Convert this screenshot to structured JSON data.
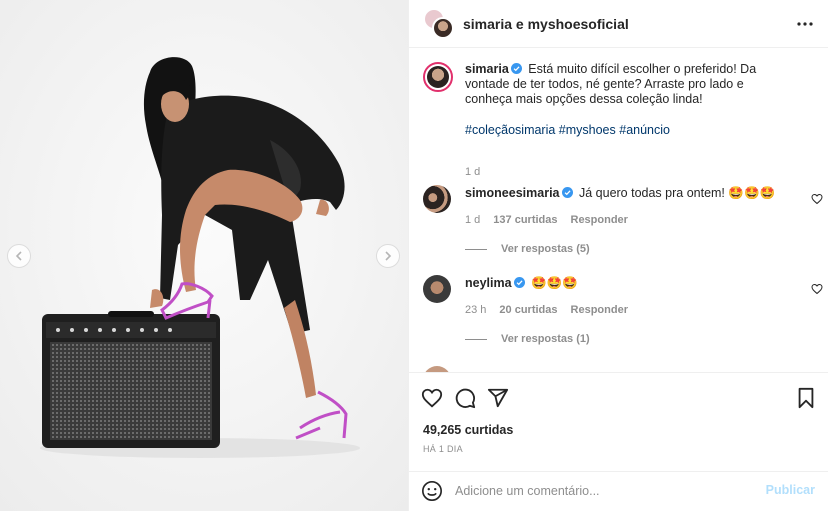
{
  "header": {
    "title": "simaria e myshoesoficial",
    "more_icon": "more-horizontal-icon"
  },
  "caption": {
    "username": "simaria",
    "text": "Está muito difícil escolher o preferido! Da vontade de ter todos, né gente? Arraste pro lado e conheça mais opções dessa coleção linda!",
    "hashtags": "#coleçãosimaria #myshoes #anúncio",
    "time": "1 d"
  },
  "comments": [
    {
      "username": "simoneesimaria",
      "text": "Já quero todas pra ontem! 🤩🤩🤩",
      "time": "1 d",
      "likes": "137 curtidas",
      "reply": "Responder",
      "view_replies": "Ver respostas (5)"
    },
    {
      "username": "neylima",
      "text": "🤩🤩🤩",
      "time": "23 h",
      "likes": "20 curtidas",
      "reply": "Responder",
      "view_replies": "Ver respostas (1)"
    }
  ],
  "actions": {
    "likes_count": "49,265 curtidas",
    "time_ago": "HÁ 1 DIA"
  },
  "add_comment": {
    "placeholder": "Adicione um comentário...",
    "post_label": "Publicar"
  },
  "colors": {
    "verified": "#3897f0",
    "hashtag": "#00376b",
    "post_button_disabled": "#b2dffc",
    "heels": "#c04fc6"
  }
}
